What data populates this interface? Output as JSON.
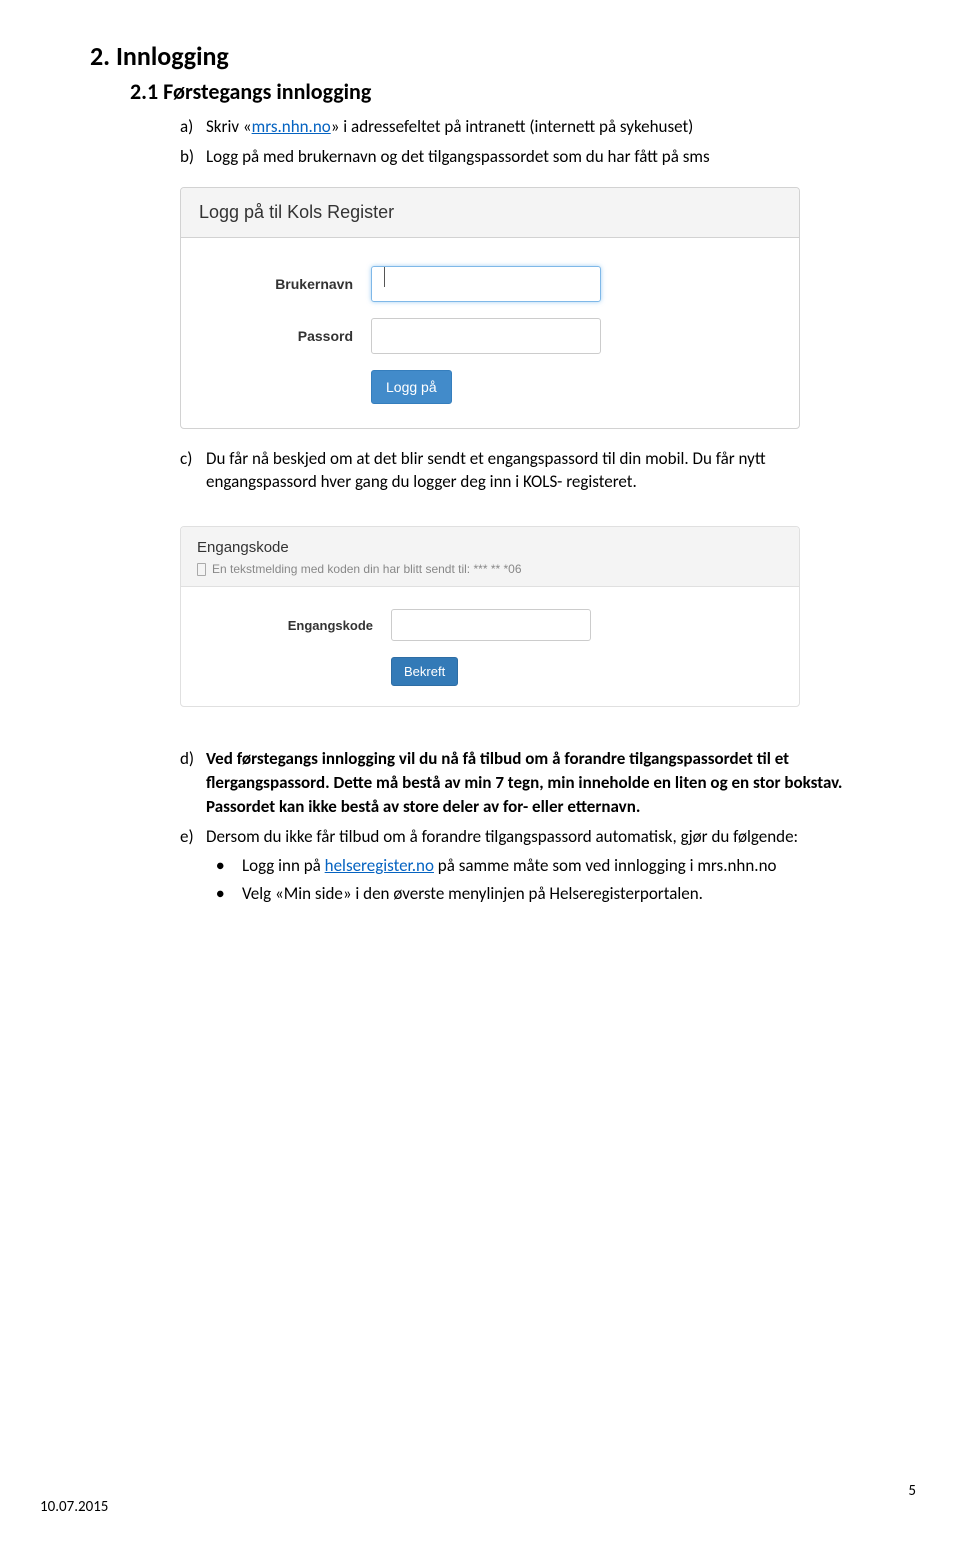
{
  "headings": {
    "h2": "2. Innlogging",
    "h3": "2.1   Førstegangs innlogging"
  },
  "list_a": {
    "marker": "a)",
    "prefix": "Skriv «",
    "link": "mrs.nhn.no",
    "suffix": "» i adressefeltet på intranett (internett på sykehuset)"
  },
  "list_b": {
    "marker": "b)",
    "text": "Logg på med brukernavn og det tilgangspassordet som du har fått på sms"
  },
  "panel1": {
    "title": "Logg på til Kols Register",
    "username_label": "Brukernavn",
    "password_label": "Passord",
    "login_btn": "Logg på"
  },
  "list_c": {
    "marker": "c)",
    "text": "Du får nå beskjed om at det blir sendt et engangspassord til din mobil. Du får nytt engangspassord hver gang du logger deg inn i KOLS- registeret."
  },
  "panel2": {
    "title": "Engangskode",
    "message": "En tekstmelding med koden din har blitt sendt til: *** ** *06",
    "code_label": "Engangskode",
    "confirm_btn": "Bekreft"
  },
  "list_d": {
    "marker": "d)",
    "text": "Ved førstegangs innlogging vil du nå få tilbud om å forandre tilgangspassordet til et flergangspassord. Dette må bestå av min 7 tegn, min inneholde en liten og en stor bokstav. Passordet kan ikke bestå av store deler av for- eller etternavn."
  },
  "list_e": {
    "marker": "e)",
    "text": "Dersom du ikke får tilbud om å forandre tilgangspassord automatisk, gjør du følgende:"
  },
  "sub1": {
    "prefix": "Logg inn på ",
    "link": "helseregister.no",
    "suffix": " på samme måte som ved innlogging i mrs.nhn.no"
  },
  "sub2": {
    "text": "Velg «Min side» i den øverste menylinjen på Helseregisterportalen."
  },
  "footer": {
    "date": "10.07.2015",
    "page": "5"
  }
}
